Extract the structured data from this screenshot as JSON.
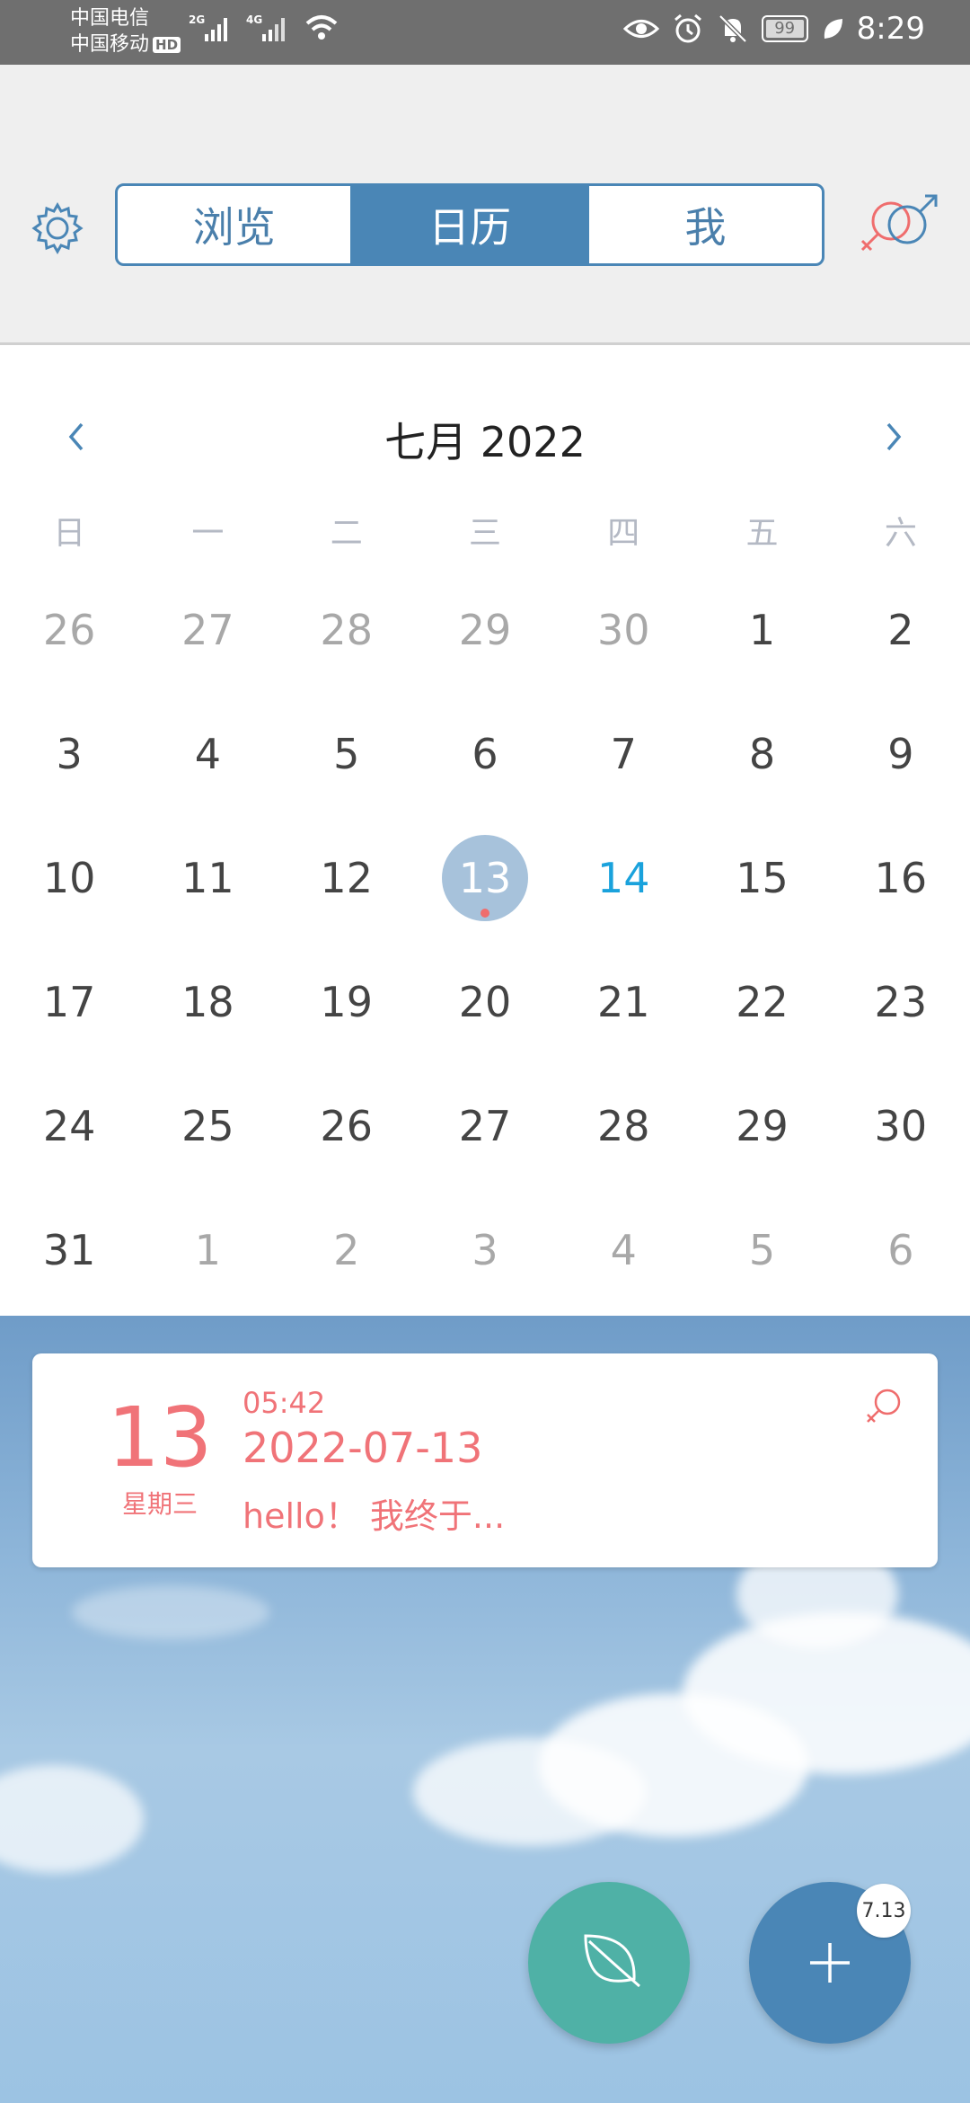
{
  "status_bar": {
    "carrier1": "中国电信",
    "carrier2": "中国移动",
    "hd": "HD",
    "signal1_label": "2G",
    "signal2_label": "4G",
    "battery": "99",
    "time": "8:29"
  },
  "header": {
    "tabs": [
      {
        "label": "浏览"
      },
      {
        "label": "日历"
      },
      {
        "label": "我"
      }
    ],
    "active_tab_index": 1,
    "accent_color": "#4a86b6"
  },
  "calendar": {
    "title": "七月 2022",
    "weekdays": [
      "日",
      "一",
      "二",
      "三",
      "四",
      "五",
      "六"
    ],
    "weeks": [
      [
        "26",
        "27",
        "28",
        "29",
        "30",
        "1",
        "2"
      ],
      [
        "3",
        "4",
        "5",
        "6",
        "7",
        "8",
        "9"
      ],
      [
        "10",
        "11",
        "12",
        "13",
        "14",
        "15",
        "16"
      ],
      [
        "17",
        "18",
        "19",
        "20",
        "21",
        "22",
        "23"
      ],
      [
        "24",
        "25",
        "26",
        "27",
        "28",
        "29",
        "30"
      ],
      [
        "31",
        "1",
        "2",
        "3",
        "4",
        "5",
        "6"
      ]
    ],
    "selected_day": "13",
    "today": "14"
  },
  "entry": {
    "day": "13",
    "weekday": "星期三",
    "time": "05:42",
    "date": "2022-07-13",
    "text": "hello！ 我终于..."
  },
  "fab": {
    "badge": "7.13"
  }
}
